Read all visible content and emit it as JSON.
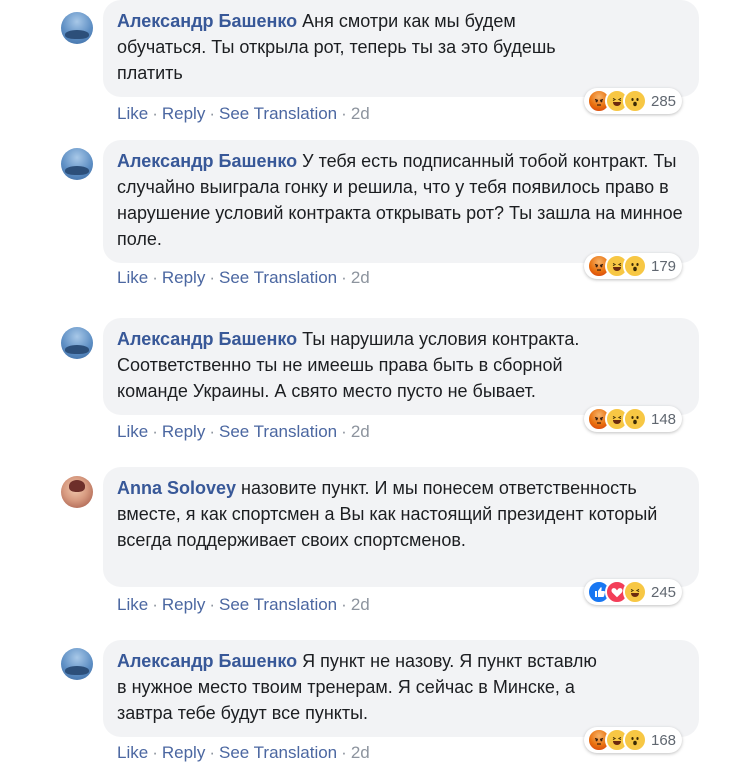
{
  "actions": {
    "like": "Like",
    "reply": "Reply",
    "translate": "See Translation",
    "separator": "·"
  },
  "comments": [
    {
      "author": "Александр Башенко",
      "text": "Аня смотри как мы будем обучаться. Ты открыла рот, теперь ты за это будешь платить",
      "time": "2d",
      "reactions": [
        "angry",
        "haha",
        "wow"
      ],
      "reaction_count": "285"
    },
    {
      "author": "Александр Башенко",
      "text": "У тебя есть подписанный тобой контракт. Ты случайно выиграла гонку и решила, что у тебя появилось право в нарушение условий контракта открывать рот? Ты зашла на минное поле.",
      "time": "2d",
      "reactions": [
        "angry",
        "haha",
        "wow"
      ],
      "reaction_count": "179"
    },
    {
      "author": "Александр Башенко",
      "text": "Ты нарушила условия контракта. Соответственно ты не имеешь права быть в сборной команде Украины. А свято место пусто не бывает.",
      "time": "2d",
      "reactions": [
        "angry",
        "haha",
        "wow"
      ],
      "reaction_count": "148"
    },
    {
      "author": "Anna Solovey",
      "text": "назовите пункт. И мы понесем ответственность вместе, я как спортсмен а Вы как настоящий президент который всегда поддерживает своих спортсменов.",
      "time": "2d",
      "reactions": [
        "like",
        "love",
        "haha"
      ],
      "reaction_count": "245"
    },
    {
      "author": "Александр Башенко",
      "text": "Я пункт не назову. Я пункт вставлю в нужное место твоим тренерам. Я сейчас в Минске, а завтра тебе будут все пункты.",
      "time": "2d",
      "reactions": [
        "angry",
        "haha",
        "wow"
      ],
      "reaction_count": "168"
    }
  ]
}
